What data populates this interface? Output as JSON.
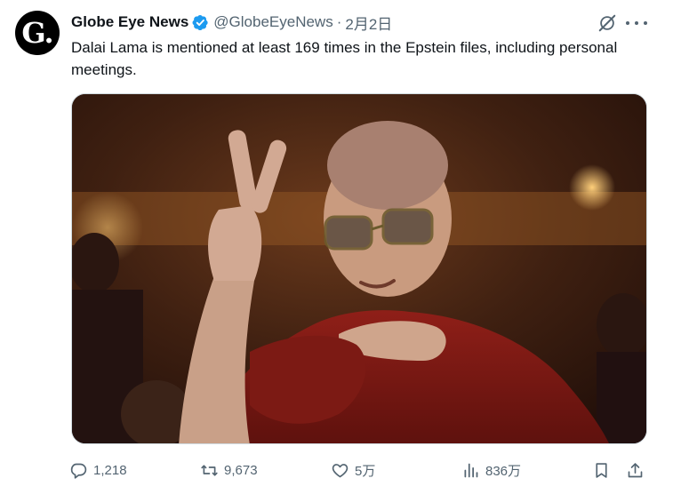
{
  "tweet": {
    "author_name": "Globe Eye News",
    "handle": "@GlobeEyeNews",
    "separator": "·",
    "date": "2月2日",
    "avatar_letter": "G.",
    "text": "Dalai Lama is mentioned at least 169 times in the Epstein files, including personal meetings.",
    "media_description": "Photo of the Dalai Lama in maroon robes making a peace sign"
  },
  "actions": {
    "replies": "1,218",
    "reposts": "9,673",
    "likes": "5万",
    "views": "836万"
  },
  "icons": {
    "verified": "verified-badge-icon",
    "grok": "grok-icon",
    "more": "more-icon",
    "reply": "reply-icon",
    "repost": "repost-icon",
    "like": "heart-icon",
    "views": "views-icon",
    "bookmark": "bookmark-icon",
    "share": "share-icon"
  },
  "colors": {
    "text": "#0f1419",
    "secondary": "#536471",
    "verified": "#1d9bf0",
    "border": "#cfd9de"
  }
}
